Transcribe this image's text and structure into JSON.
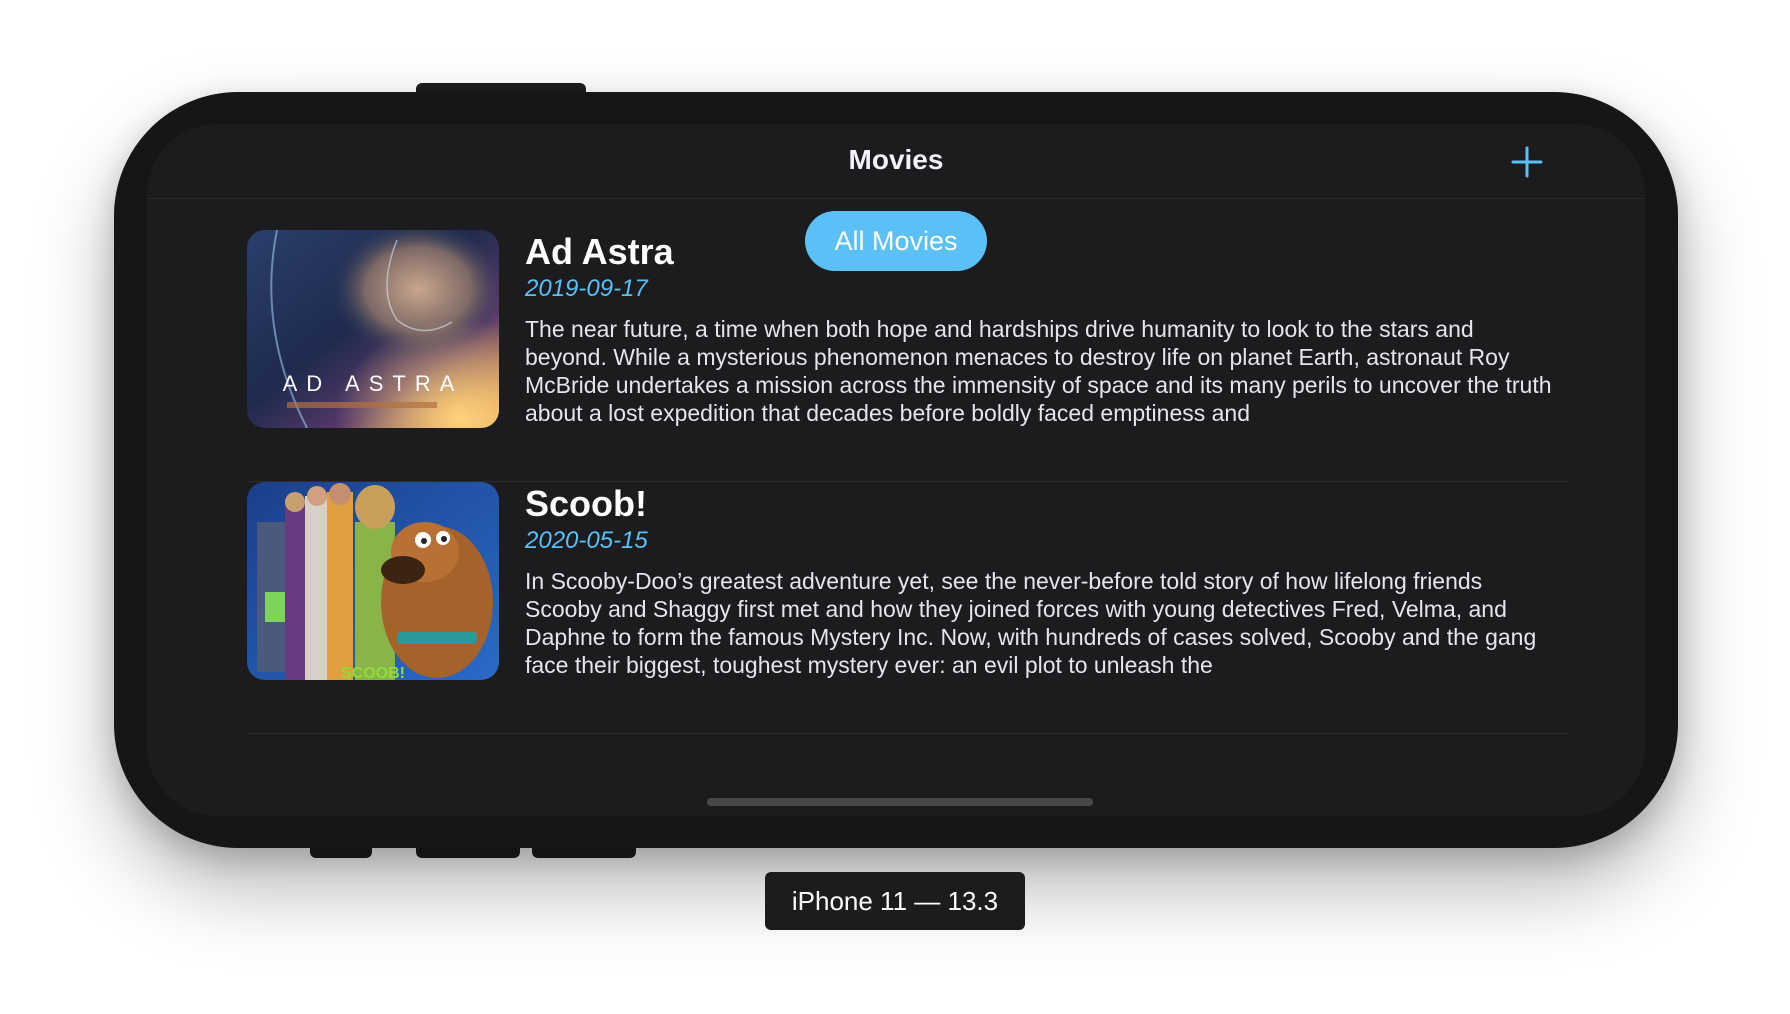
{
  "nav": {
    "title": "Movies",
    "add_icon": "plus-icon",
    "accent_color": "#5ac0f6"
  },
  "filter": {
    "label": "All Movies"
  },
  "movies": [
    {
      "title": "Ad Astra",
      "date": "2019-09-17",
      "description": "The near future, a time when both hope and hardships drive humanity to look to the stars and beyond. While a mysterious phenomenon menaces to destroy life on planet Earth, astronaut Roy McBride undertakes a mission across the immensity of space and its many perils to uncover the truth about a lost expedition that decades before boldly faced emptiness and",
      "poster_text": "AD ASTRA"
    },
    {
      "title": "Scoob!",
      "date": "2020-05-15",
      "description": "In Scooby-Doo’s greatest adventure yet, see the never-before told story of how lifelong friends Scooby and Shaggy first met and how they joined forces with young detectives Fred, Velma, and Daphne to form the famous Mystery Inc. Now, with hundreds of cases solved, Scooby and the gang face their biggest, toughest mystery ever: an evil plot to unleash the"
    }
  ],
  "device": {
    "label": "iPhone 11 — 13.3"
  },
  "colors": {
    "screen_background": "#1c1c1e",
    "date_color": "#5ac0f6",
    "pill_color": "#5ac0f6"
  }
}
